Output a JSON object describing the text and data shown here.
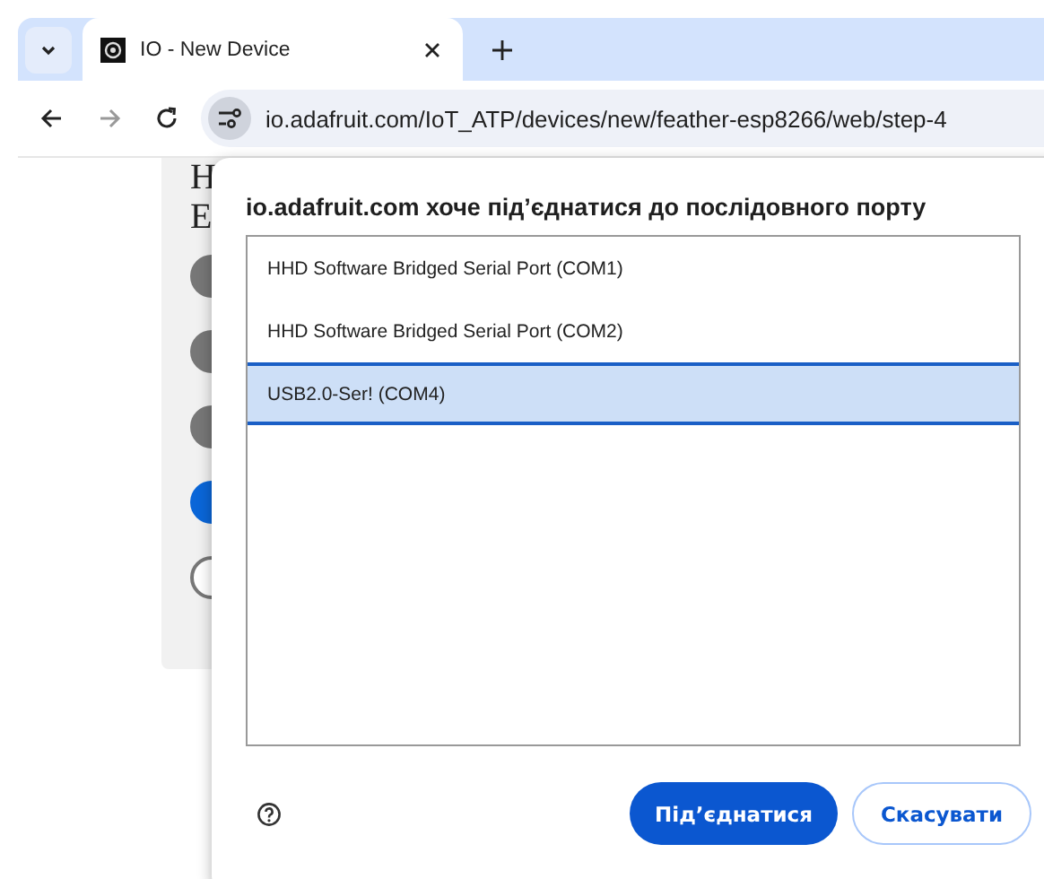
{
  "browser": {
    "tab": {
      "title": "IO - New Device"
    },
    "url": "io.adafruit.com/IoT_ATP/devices/new/feather-esp8266/web/step-4"
  },
  "page": {
    "heading_lines": [
      "H",
      "E"
    ],
    "steps": [
      {
        "done": true,
        "current": false
      },
      {
        "done": true,
        "current": false
      },
      {
        "done": true,
        "current": false
      },
      {
        "done": false,
        "current": true
      },
      {
        "done": false,
        "current": false
      }
    ]
  },
  "dialog": {
    "title": "io.adafruit.com хоче під’єднатися до послідовного порту",
    "ports": [
      {
        "label": "HHD Software Bridged Serial Port (COM1)",
        "selected": false
      },
      {
        "label": "HHD Software Bridged Serial Port (COM2)",
        "selected": false
      },
      {
        "label": "USB2.0-Ser! (COM4)",
        "selected": true
      }
    ],
    "buttons": [
      {
        "label": "Під’єднатися",
        "kind": "primary"
      },
      {
        "label": "Скасувати",
        "kind": "secondary"
      }
    ]
  }
}
